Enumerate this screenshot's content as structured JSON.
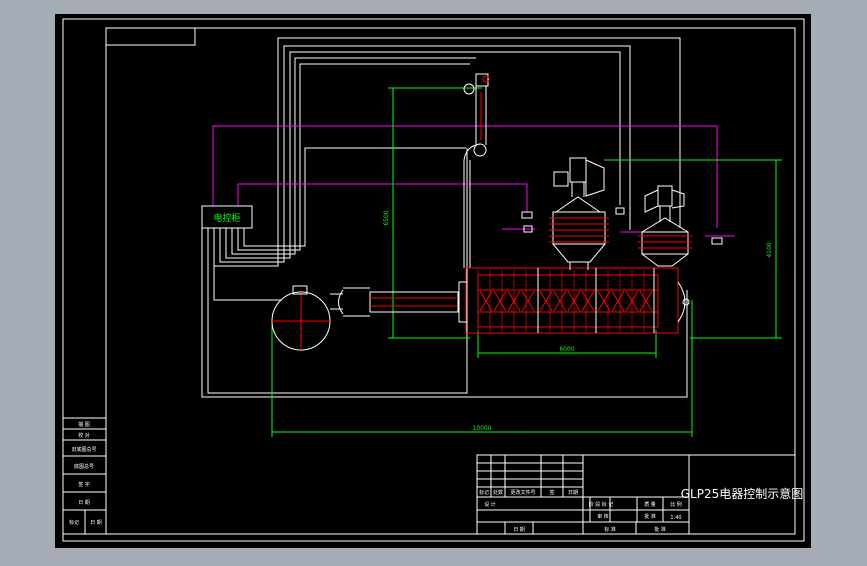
{
  "drawing": {
    "title": "GLP25电器控制示意图",
    "control_cabinet_label": "电控柜"
  },
  "dimensions": {
    "vertical_left": "6500",
    "vertical_right": "4100",
    "furnace_length": "6000",
    "overall_length": "10000"
  },
  "title_block": {
    "left_column": [
      "描  图",
      "校  对",
      "旧底图总号",
      "底图总号",
      "签  字",
      "日  期"
    ],
    "left_bottom_row": [
      "标记",
      "日  期"
    ],
    "center_labels": [
      "标记",
      "处数",
      "更改文件号",
      "签",
      "日期",
      "设  计"
    ],
    "bottom_labels": [
      "日  期",
      "审  核",
      "批  准",
      "标  准",
      "批  准"
    ],
    "right_labels": [
      "阶 段 标 记",
      "质 量",
      "比 例",
      "1:40"
    ]
  },
  "colors": {
    "background": "#000000",
    "frame": "#ffffff",
    "dimension": "#00ff00",
    "signal_wire": "#ff00ff",
    "equipment": "#ff0000",
    "cabinet": "#00ff00"
  }
}
